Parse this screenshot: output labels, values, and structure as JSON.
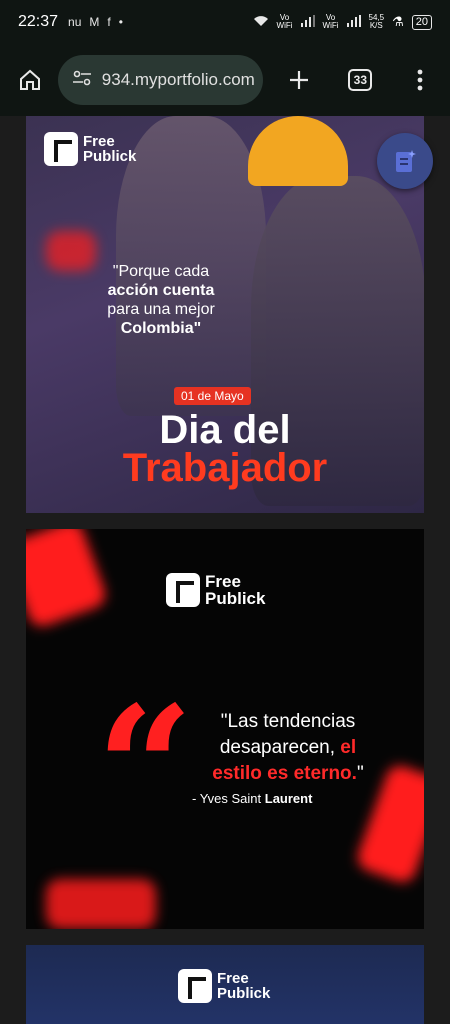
{
  "status_bar": {
    "time": "22:37",
    "notifications": [
      "nu",
      "M",
      "f",
      "•"
    ],
    "wifi_label_1": "Vo\nWiFi",
    "wifi_label_2": "Vo\nWiFi",
    "speed": "54,5\nK/S",
    "battery": "20"
  },
  "browser": {
    "url": "934.myportfolio.com",
    "tab_count": "33"
  },
  "cards": [
    {
      "logo_text": "Free\nPublick",
      "quote_line1": "\"Porque cada",
      "quote_bold1": "acción cuenta",
      "quote_line2": "para una mejor",
      "quote_bold2": "Colombia",
      "quote_end": "\"",
      "date": "01 de Mayo",
      "title_a": "Dia del",
      "title_b": "Trabajador"
    },
    {
      "logo_text": "Free\nPublick",
      "quote_a": "\"Las tendencias desaparecen, ",
      "quote_red_a": "el",
      "quote_red_b": "estilo es eterno.",
      "quote_end": "\"",
      "author_prefix": "- Yves Saint ",
      "author_bold": "Laurent"
    },
    {
      "logo_text": "Free\nPublick"
    }
  ],
  "colors": {
    "accent_red": "#ff2a2a",
    "toolbar_bg": "#0f1512",
    "urlbar_bg": "#2a3833"
  }
}
